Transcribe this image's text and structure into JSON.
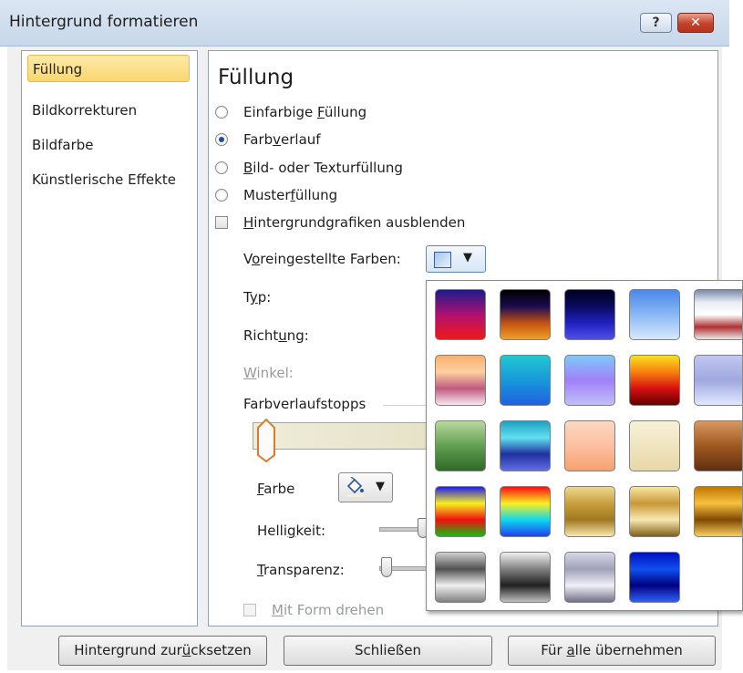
{
  "window": {
    "title": "Hintergrund formatieren",
    "help_label": "?",
    "close_label": "✕"
  },
  "sidebar": {
    "items": [
      {
        "label": "Füllung",
        "selected": true
      },
      {
        "label": "Bildkorrekturen",
        "selected": false
      },
      {
        "label": "Bildfarbe",
        "selected": false
      },
      {
        "label": "Künstlerische Effekte",
        "selected": false
      }
    ]
  },
  "main": {
    "heading": "Füllung",
    "options": [
      {
        "pre": "Einfarbige ",
        "key": "F",
        "post": "üllung",
        "selected": false
      },
      {
        "pre": "Farb",
        "key": "v",
        "post": "erlauf",
        "selected": true
      },
      {
        "pre": "",
        "key": "B",
        "post": "ild- oder Texturfüllung",
        "selected": false
      },
      {
        "pre": "Muster",
        "key": "f",
        "post": "üllung",
        "selected": false
      }
    ],
    "hide_graphics": {
      "pre": "",
      "key": "H",
      "post": "intergrundgrafiken ausblenden",
      "checked": false
    },
    "preset_label": {
      "pre": "V",
      "key": "o",
      "post": "reingestellte Farben:"
    },
    "type_label": {
      "pre": "T",
      "key": "y",
      "post": "p:"
    },
    "direction_label": {
      "pre": "Richt",
      "key": "u",
      "post": "ng:"
    },
    "angle_label": {
      "pre": "",
      "key": "W",
      "post": "inkel:"
    },
    "stops_label": "Farbverlaufstopps",
    "color_label": {
      "pre": "",
      "key": "F",
      "post": "arbe"
    },
    "brightness_label": {
      "pre": "Helli",
      "key": "g",
      "post": "keit:"
    },
    "transparency_label": {
      "pre": "",
      "key": "T",
      "post": "ransparenz:"
    },
    "rotate_with_shape": {
      "pre": "",
      "key": "M",
      "post": "it Form drehen",
      "checked": false
    },
    "dropdown_arrow": "▼",
    "color_button_icon": "paint-bucket-icon"
  },
  "presets": {
    "colors_note": "gradient swatches",
    "swatches": [
      [
        "#1b1b8c",
        "#b11070",
        "#f01818"
      ],
      [
        "#000000",
        "#1a0a50",
        "#c25010",
        "#f0a028"
      ],
      [
        "#000020",
        "#0a0a60",
        "#2020c0",
        "#5050e8"
      ],
      [
        "#4a88e8",
        "#8ab8f4",
        "#d8e8fc"
      ],
      [
        "#7a8aa8",
        "#e8ecf4",
        "#ffffff",
        "#b03030",
        "#e8e8e8"
      ],
      [
        "#f8b070",
        "#fcd0a0",
        "#c05a80",
        "#f8e8f0"
      ],
      [
        "#20c8d0",
        "#1898d8",
        "#2060e0"
      ],
      [
        "#80c8f8",
        "#a080f8",
        "#c0c0f8"
      ],
      [
        "#f8e020",
        "#f88010",
        "#d81010",
        "#600000"
      ],
      [
        "#c0c8f0",
        "#a0a8e0",
        "#e0e8ff"
      ],
      [
        "#b8d8a0",
        "#60a050",
        "#306828"
      ],
      [
        "#20a0c0",
        "#60e0f0",
        "#2030a0",
        "#6070e0"
      ],
      [
        "#fcd8c0",
        "#fcc0a0",
        "#f8a070"
      ],
      [
        "#f8f0d8",
        "#f0e4c0",
        "#e8d8a8"
      ],
      [
        "#d89860",
        "#a05820",
        "#603010"
      ],
      [
        "#2020e0",
        "#f8f020",
        "#f01010",
        "#10c010"
      ],
      [
        "#f81010",
        "#f8f020",
        "#10d8f0",
        "#2040f0"
      ],
      [
        "#f0d890",
        "#c8a040",
        "#a07820",
        "#f8e8b0"
      ],
      [
        "#f8e8a0",
        "#c89838",
        "#f8e8b0",
        "#806018"
      ],
      [
        "#c07800",
        "#f8c040",
        "#804800",
        "#f8d060"
      ],
      [
        "#d0d0d0",
        "#505050",
        "#f0f0f0",
        "#808080"
      ],
      [
        "#f0f0f0",
        "#808080",
        "#202020",
        "#c0c0c0"
      ],
      [
        "#d8d8e8",
        "#a0a0b8",
        "#f0f0f8",
        "#707088"
      ],
      [
        "#0010c0",
        "#1050f0",
        "#000080",
        "#3060f8"
      ]
    ]
  },
  "footer": {
    "reset": {
      "pre": "Hintergrund zur",
      "key": "ü",
      "post": "cksetzen"
    },
    "close": "Schließen",
    "apply_all": {
      "pre": "Für ",
      "key": "a",
      "post": "lle übernehmen"
    }
  }
}
